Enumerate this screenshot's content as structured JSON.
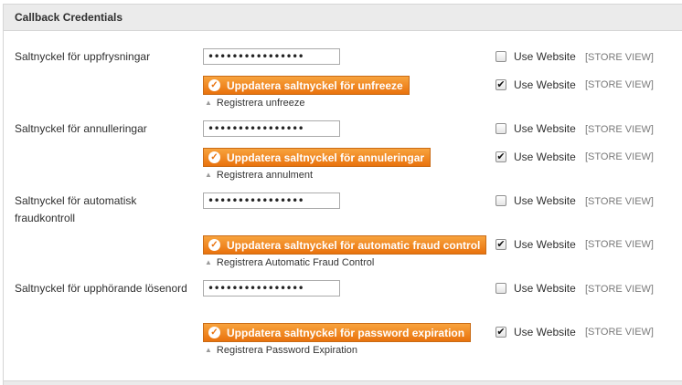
{
  "section": {
    "title": "Callback Credentials"
  },
  "rows": [
    {
      "label": "Saltnyckel för uppfrysningar",
      "password": "••••••••••••••••",
      "button": "Uppdatera saltnyckel för unfreeze",
      "note": "Registrera unfreeze",
      "use_website_1": "Use Website",
      "use_website_2": "Use Website",
      "scope_1": "[STORE VIEW]",
      "scope_2": "[STORE VIEW]",
      "checked_1": false,
      "checked_2": true
    },
    {
      "label": "Saltnyckel för annulleringar",
      "password": "••••••••••••••••",
      "button": "Uppdatera saltnyckel för annuleringar",
      "note": "Registrera annulment",
      "use_website_1": "Use Website",
      "use_website_2": "Use Website",
      "scope_1": "[STORE VIEW]",
      "scope_2": "[STORE VIEW]",
      "checked_1": false,
      "checked_2": true
    },
    {
      "label": "Saltnyckel för automatisk fraudkontroll",
      "password": "••••••••••••••••",
      "button": "Uppdatera saltnyckel för automatic fraud control",
      "note": "Registrera Automatic Fraud Control",
      "use_website_1": "Use Website",
      "use_website_2": "Use Website",
      "scope_1": "[STORE VIEW]",
      "scope_2": "[STORE VIEW]",
      "checked_1": false,
      "checked_2": true
    },
    {
      "label": "Saltnyckel för upphörande lösenord",
      "password": "••••••••••••••••",
      "button": "Uppdatera saltnyckel för password expiration",
      "note": "Registrera Password Expiration",
      "use_website_1": "Use Website",
      "use_website_2": "Use Website",
      "scope_1": "[STORE VIEW]",
      "scope_2": "[STORE VIEW]",
      "checked_1": false,
      "checked_2": true
    }
  ],
  "icons": {
    "button_icon": "check-circle-icon",
    "note_icon": "triangle-up-icon",
    "checkbox_mark": "checkmark-icon"
  },
  "colors": {
    "button": "#f18a1f",
    "header_bg": "#ebebeb",
    "scope_text": "#7a7a7a"
  }
}
